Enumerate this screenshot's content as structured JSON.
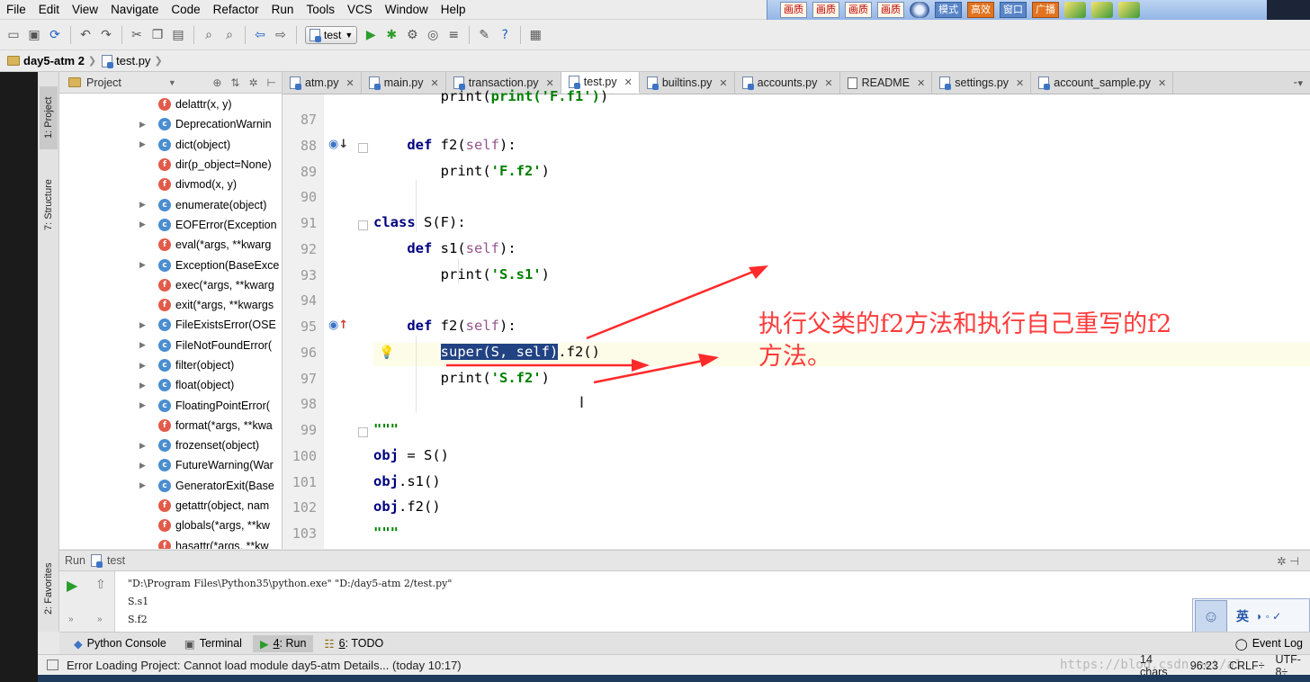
{
  "menu": [
    "File",
    "Edit",
    "View",
    "Navigate",
    "Code",
    "Refactor",
    "Run",
    "Tools",
    "VCS",
    "Window",
    "Help"
  ],
  "skin_buttons": [
    "画质",
    "画质",
    "画质",
    "画质"
  ],
  "skin_buttons2": [
    "模式",
    "高效",
    "窗口",
    "广播"
  ],
  "toolbar": {
    "run_config": "test"
  },
  "breadcrumb": {
    "project": "day5-atm 2",
    "file": "test.py"
  },
  "project_panel": {
    "title": "Project",
    "items": [
      {
        "kind": "f",
        "label": "delattr(x, y)",
        "expandable": false
      },
      {
        "kind": "c",
        "label": "DeprecationWarnin",
        "expandable": true
      },
      {
        "kind": "c",
        "label": "dict(object)",
        "expandable": true
      },
      {
        "kind": "f",
        "label": "dir(p_object=None)",
        "expandable": false
      },
      {
        "kind": "f",
        "label": "divmod(x, y)",
        "expandable": false
      },
      {
        "kind": "c",
        "label": "enumerate(object)",
        "expandable": true
      },
      {
        "kind": "c",
        "label": "EOFError(Exception",
        "expandable": true
      },
      {
        "kind": "f",
        "label": "eval(*args, **kwarg",
        "expandable": false
      },
      {
        "kind": "c",
        "label": "Exception(BaseExce",
        "expandable": true
      },
      {
        "kind": "f",
        "label": "exec(*args, **kwarg",
        "expandable": false
      },
      {
        "kind": "f",
        "label": "exit(*args, **kwargs",
        "expandable": false
      },
      {
        "kind": "c",
        "label": "FileExistsError(OSE",
        "expandable": true
      },
      {
        "kind": "c",
        "label": "FileNotFoundError(",
        "expandable": true
      },
      {
        "kind": "c",
        "label": "filter(object)",
        "expandable": true
      },
      {
        "kind": "c",
        "label": "float(object)",
        "expandable": true
      },
      {
        "kind": "c",
        "label": "FloatingPointError(",
        "expandable": true
      },
      {
        "kind": "f",
        "label": "format(*args, **kwa",
        "expandable": false
      },
      {
        "kind": "c",
        "label": "frozenset(object)",
        "expandable": true
      },
      {
        "kind": "c",
        "label": "FutureWarning(War",
        "expandable": true
      },
      {
        "kind": "c",
        "label": "GeneratorExit(Base",
        "expandable": true
      },
      {
        "kind": "f",
        "label": "getattr(object, nam",
        "expandable": false
      },
      {
        "kind": "f",
        "label": "globals(*args, **kw",
        "expandable": false
      },
      {
        "kind": "f",
        "label": "hasattr(*args, **kw",
        "expandable": false
      }
    ]
  },
  "side_tabs": {
    "project": "1: Project",
    "structure": "7: Structure",
    "favorites": "2: Favorites"
  },
  "editor_tabs": [
    {
      "label": "atm.py",
      "active": false,
      "type": "py"
    },
    {
      "label": "main.py",
      "active": false,
      "type": "py"
    },
    {
      "label": "transaction.py",
      "active": false,
      "type": "py"
    },
    {
      "label": "test.py",
      "active": true,
      "type": "py"
    },
    {
      "label": "builtins.py",
      "active": false,
      "type": "py"
    },
    {
      "label": "accounts.py",
      "active": false,
      "type": "py"
    },
    {
      "label": "README",
      "active": false,
      "type": "txt"
    },
    {
      "label": "settings.py",
      "active": false,
      "type": "py"
    },
    {
      "label": "account_sample.py",
      "active": false,
      "type": "py"
    }
  ],
  "code": {
    "line_numbers": [
      "87",
      "88",
      "89",
      "90",
      "91",
      "92",
      "93",
      "94",
      "95",
      "96",
      "97",
      "98",
      "99",
      "100",
      "101",
      "102",
      "103"
    ],
    "partial_top": "print('F.f1')"
  },
  "annotation": {
    "line1": "执行父类的f2方法和执行自己重写的f2",
    "line2": "方法。"
  },
  "run_panel": {
    "title": "Run",
    "config": "test",
    "command": "\"D:\\Program Files\\Python35\\python.exe\" \"D:/day5-atm 2/test.py\"",
    "output": [
      "S.s1",
      "S.f2"
    ]
  },
  "bottom_tabs": [
    {
      "label": "Python Console",
      "prefix": "",
      "active": false
    },
    {
      "label": "Terminal",
      "prefix": "",
      "active": false
    },
    {
      "label": "Run",
      "prefix": "4",
      "active": true
    },
    {
      "label": "TODO",
      "prefix": "6",
      "active": false
    }
  ],
  "event_log": "Event Log",
  "status": {
    "message": "Error Loading Project: Cannot load module day5-atm Details... (today 10:17)",
    "chars": "14 chars",
    "position": "96:23",
    "line_sep": "CRLF÷",
    "encoding": "UTF-8÷",
    "watermark": "https://blog.csdn.net/a1"
  },
  "ime": {
    "lang": "英"
  },
  "colors": {
    "keyword": "#000080",
    "string": "#008000",
    "self": "#94558d",
    "selection": "#214283",
    "annotation": "#ff3b3b"
  }
}
